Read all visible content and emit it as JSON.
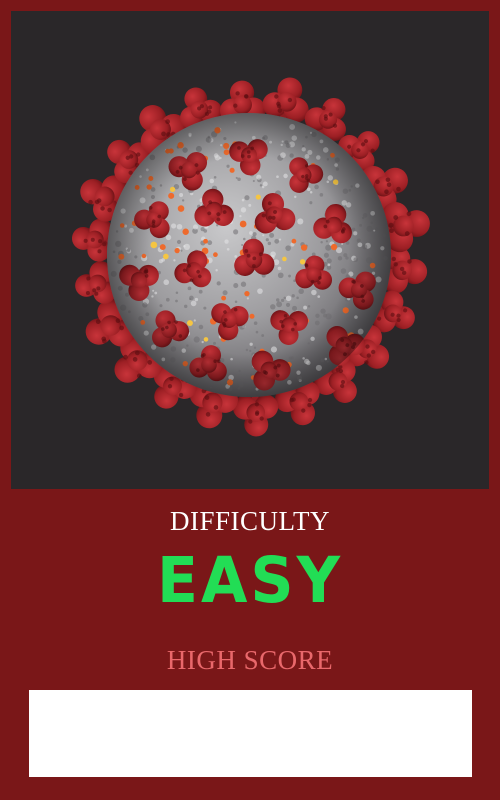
{
  "screen": {
    "difficulty_label": "DIFFICULTY",
    "difficulty_value": "EASY",
    "high_score_label": "HIGH SCORE",
    "high_score_value": ""
  },
  "image": {
    "subject": "coronavirus-illustration"
  },
  "colors": {
    "background": "#7a1718",
    "image_panel": "#2a2729",
    "difficulty_value": "#22dd55",
    "high_score_label": "#e9686b",
    "high_score_box": "#ffffff"
  }
}
